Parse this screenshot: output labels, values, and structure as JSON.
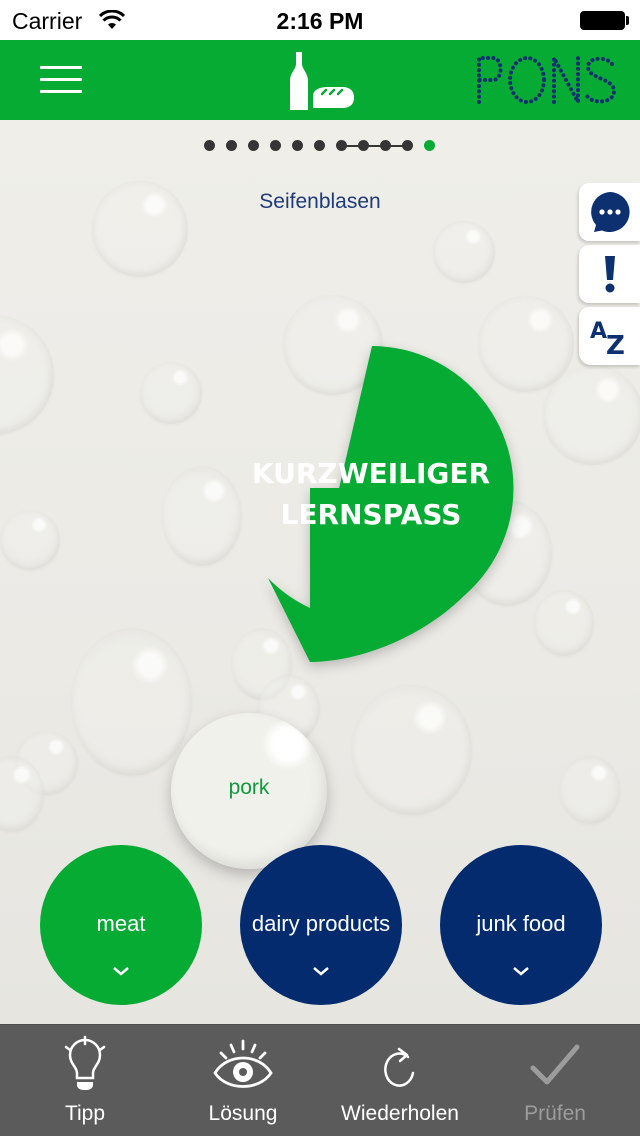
{
  "status_bar": {
    "carrier": "Carrier",
    "time": "2:16 PM",
    "wifi_icon": "wifi-icon",
    "battery_icon": "battery-full-icon"
  },
  "header": {
    "menu_icon": "hamburger-menu-icon",
    "topic_icon": "bottle-and-bread-icon",
    "brand": "PONS",
    "colors": {
      "background": "#06ab34",
      "brand": "#0d3170"
    }
  },
  "progress": {
    "total_steps": 11,
    "current_step": 11,
    "linked_steps": [
      7,
      8,
      9,
      10
    ],
    "colors": {
      "done": "#353535",
      "current": "#06ab34"
    }
  },
  "exercise": {
    "title": "Seifenblasen",
    "speech_bubble_line1": "KURZWEILIGER",
    "speech_bubble_line2": "LERNSPASS",
    "word": "pork"
  },
  "side_tabs": [
    {
      "name": "chat",
      "icon": "chat-bubble-icon"
    },
    {
      "name": "info",
      "icon": "exclamation-icon",
      "glyph": "!"
    },
    {
      "name": "dictionary",
      "icon": "a-z-icon",
      "glyph_a": "A",
      "glyph_z": "Z"
    }
  ],
  "categories": [
    {
      "label": "meat",
      "color": "#06ab34"
    },
    {
      "label": "dairy products",
      "color": "#032b6e"
    },
    {
      "label": "junk food",
      "color": "#032b6e"
    }
  ],
  "toolbar": {
    "items": [
      {
        "label": "Tipp",
        "icon": "lightbulb-icon",
        "enabled": true
      },
      {
        "label": "Lösung",
        "icon": "eye-icon",
        "enabled": true
      },
      {
        "label": "Wiederholen",
        "icon": "repeat-icon",
        "enabled": true
      },
      {
        "label": "Prüfen",
        "icon": "checkmark-icon",
        "enabled": false
      }
    ]
  }
}
